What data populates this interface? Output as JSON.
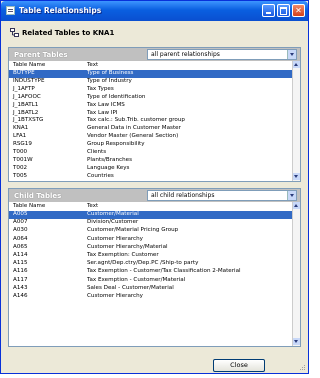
{
  "window": {
    "title": "Table Relationships"
  },
  "header": {
    "text": "Related Tables to KNA1"
  },
  "parent": {
    "title": "Parent Tables",
    "filter": "all parent relationships",
    "col_table": "Table Name",
    "col_text": "Text",
    "rows": [
      {
        "name": "BUTYPE",
        "text": "Type of Business"
      },
      {
        "name": "INDUSTYPE",
        "text": "Type of Industry"
      },
      {
        "name": "J_1AFTP",
        "text": "Tax Types"
      },
      {
        "name": "J_1AFOOC",
        "text": "Type of Identification"
      },
      {
        "name": "J_1BATL1",
        "text": "Tax Law ICMS"
      },
      {
        "name": "J_1BATL2",
        "text": "Tax Law IPI"
      },
      {
        "name": "J_1BTXSTG",
        "text": "Tax calc.: Sub.Trib. customer group"
      },
      {
        "name": "KNA1",
        "text": "General Data in Customer Master"
      },
      {
        "name": "LFA1",
        "text": "Vendor Master (General Section)"
      },
      {
        "name": "RSG19",
        "text": "Group Responsibility"
      },
      {
        "name": "T000",
        "text": "Clients"
      },
      {
        "name": "T001W",
        "text": "Plants/Branches"
      },
      {
        "name": "T002",
        "text": "Language Keys"
      },
      {
        "name": "T005",
        "text": "Countries"
      }
    ]
  },
  "child": {
    "title": "Child Tables",
    "filter": "all child relationships",
    "col_table": "Table Name",
    "col_text": "Text",
    "rows": [
      {
        "name": "A005",
        "text": "Customer/Material"
      },
      {
        "name": "A007",
        "text": "Division/Customer"
      },
      {
        "name": "A030",
        "text": "Customer/Material Pricing Group"
      },
      {
        "name": "A064",
        "text": "Customer Hierarchy"
      },
      {
        "name": "A065",
        "text": "Customer Hierarchy/Material"
      },
      {
        "name": "A114",
        "text": "Tax Exemption: Customer"
      },
      {
        "name": "A115",
        "text": "Ser.agnt/Dep.ctry/Dep.PC /Ship-to party"
      },
      {
        "name": "A116",
        "text": "Tax Exemption - Customer/Tax Classification 2-Material"
      },
      {
        "name": "A117",
        "text": "Tax Exemption - Customer/Material"
      },
      {
        "name": "A143",
        "text": "Sales Deal - Customer/Material"
      },
      {
        "name": "A146",
        "text": "Customer Hierarchy"
      }
    ]
  },
  "buttons": {
    "close": "Close"
  },
  "colors": {
    "selection": "#316ac5",
    "title_bar": "#0a5fe0"
  }
}
